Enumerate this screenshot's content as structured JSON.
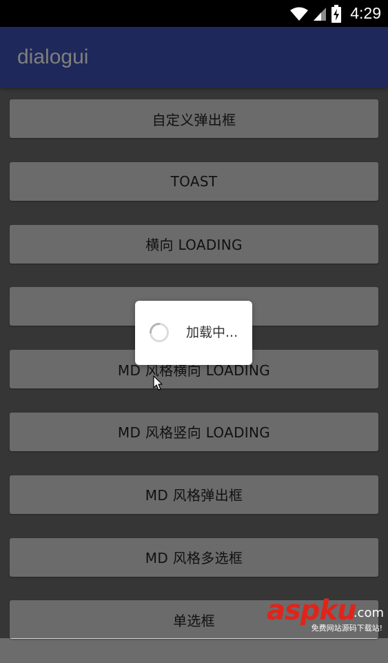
{
  "status_bar": {
    "time": "4:29",
    "icons": [
      "wifi-icon",
      "signal-icon",
      "battery-charging-icon"
    ]
  },
  "app_bar": {
    "title": "dialogui",
    "color": "#3F51B5"
  },
  "buttons": [
    {
      "label": "自定义弹出框"
    },
    {
      "label": "TOAST"
    },
    {
      "label": "横向 LOADING"
    },
    {
      "label": ""
    },
    {
      "label": "MD 风格横向 LOADING"
    },
    {
      "label": "MD 风格竖向 LOADING"
    },
    {
      "label": "MD 风格弹出框"
    },
    {
      "label": "MD 风格多选框"
    },
    {
      "label": "单选框"
    }
  ],
  "loading_dialog": {
    "text": "加载中..."
  },
  "watermark": {
    "main": "aspku",
    "suffix": ".com",
    "sub": "免费网站源码下载站!"
  }
}
